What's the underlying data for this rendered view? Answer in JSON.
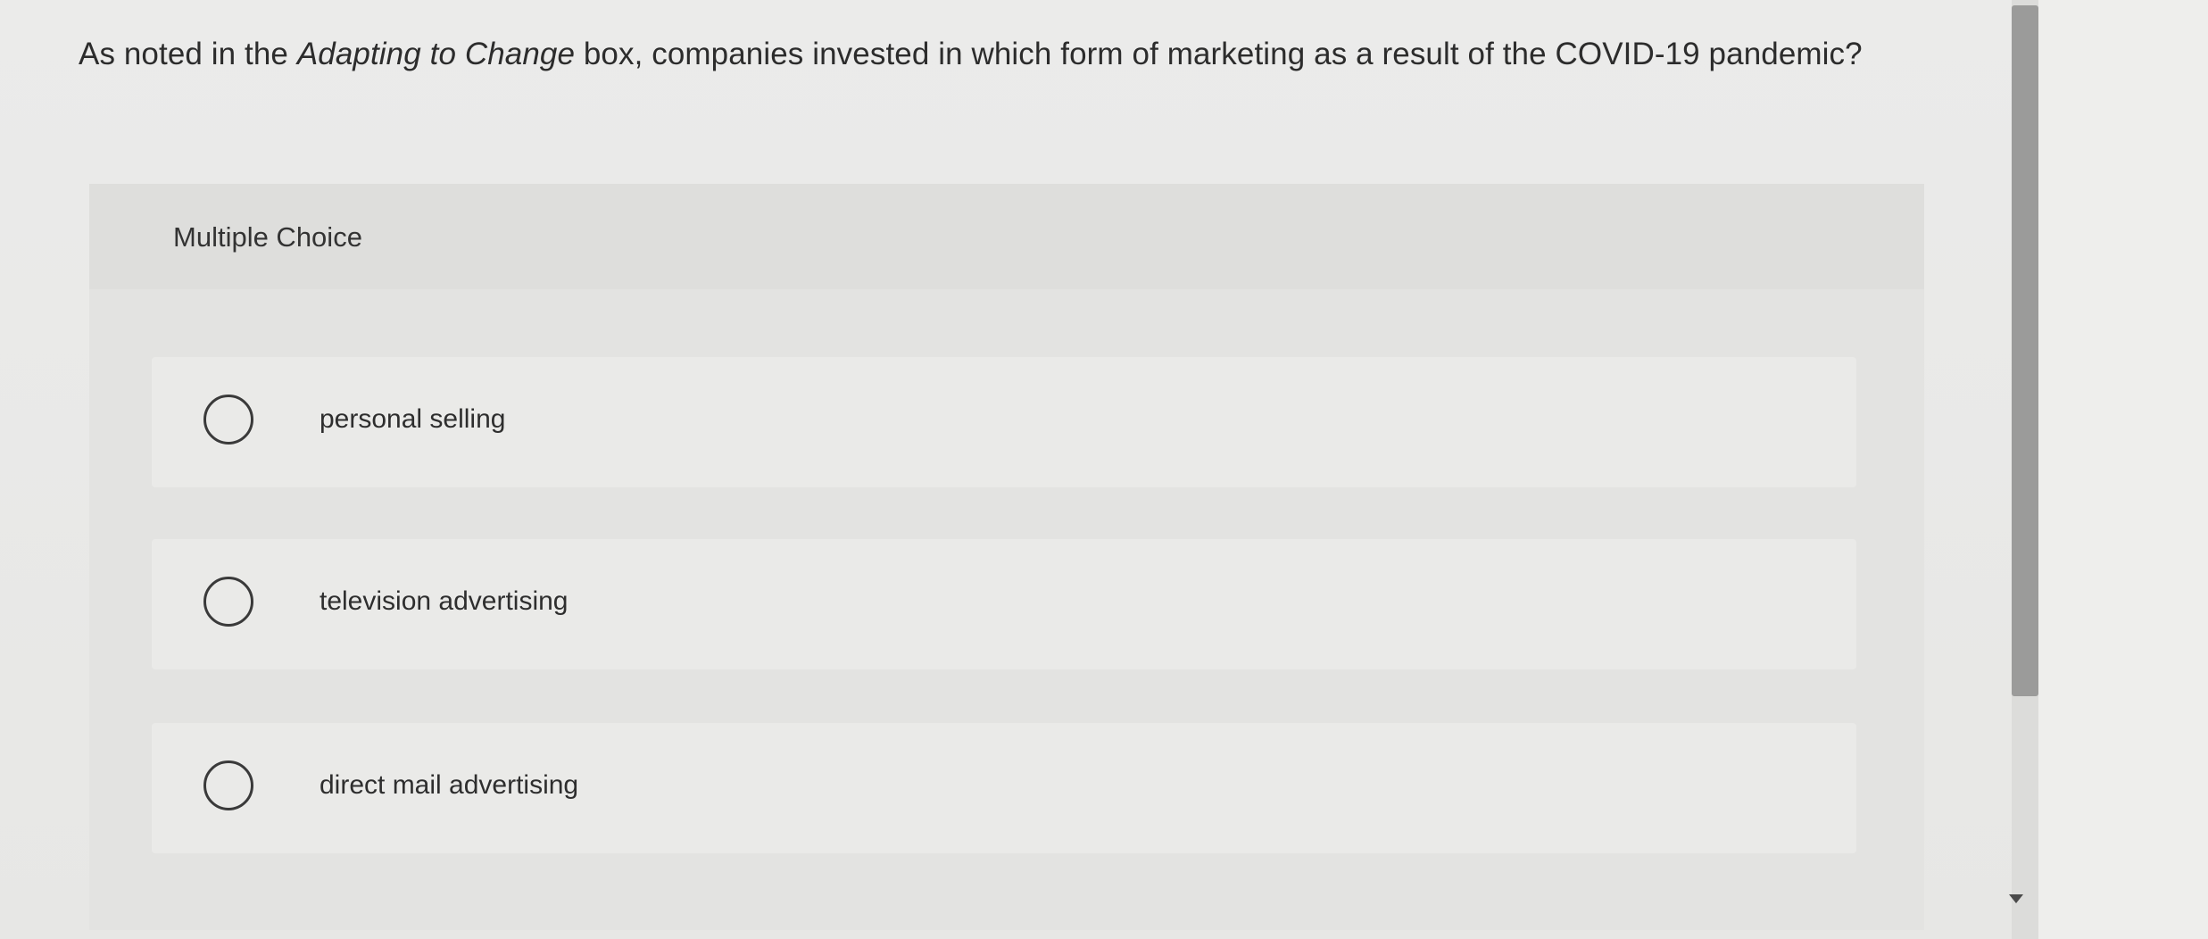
{
  "question": {
    "prefix": "As noted in the ",
    "italic": "Adapting to Change",
    "suffix": " box, companies invested in which form of marketing as a result of the COVID-19 pandemic?"
  },
  "choice_section": {
    "header_label": "Multiple Choice",
    "options": [
      {
        "label": "personal selling"
      },
      {
        "label": "television advertising"
      },
      {
        "label": "direct mail advertising"
      }
    ]
  },
  "colors": {
    "page_background": "#e9e9e7",
    "panel_background": "#e3e3e1",
    "option_background": "#eaeae8",
    "text": "#2c2c2c",
    "scrollbar_thumb": "#9b9b9a"
  }
}
